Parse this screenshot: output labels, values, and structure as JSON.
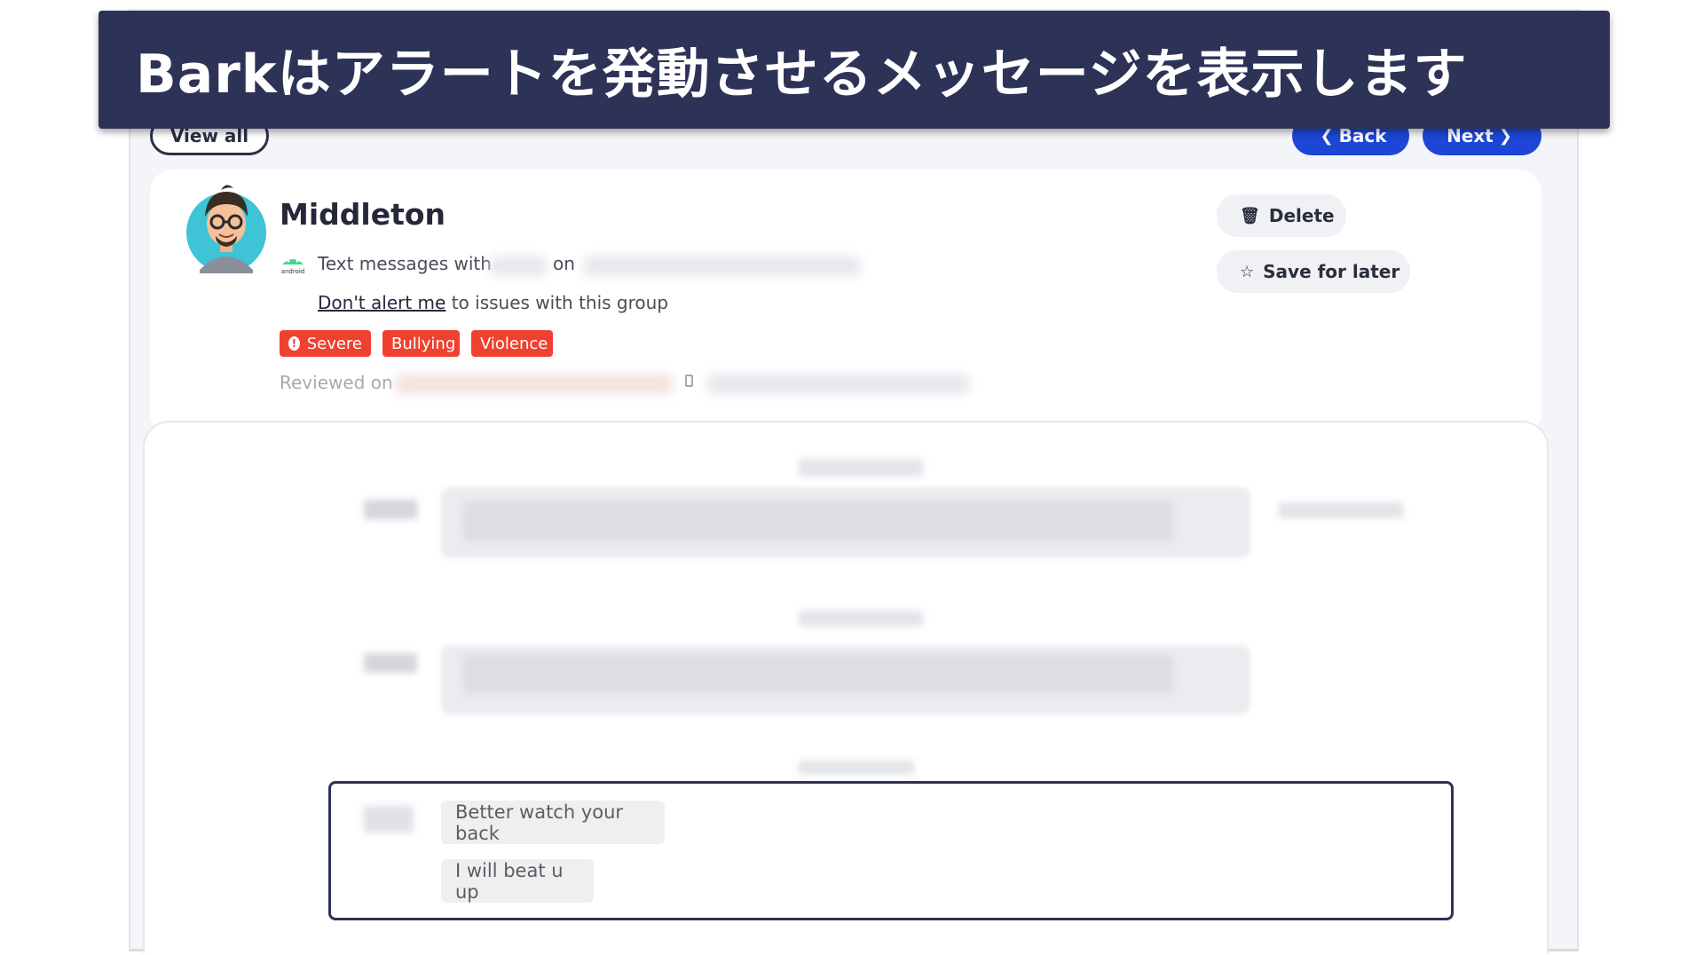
{
  "caption": {
    "text": "Barkはアラートを発動させるメッセージを表示します"
  },
  "nav": {
    "view_all_label": "View all",
    "back_label": "Back",
    "next_label": "Next"
  },
  "alert_card": {
    "name": "Middleton",
    "platform_icon": "android-icon",
    "messages_prefix": "Text messages with",
    "messages_on": "on",
    "dont_alert_link": "Don't alert me",
    "dont_alert_suffix": "to issues with this group",
    "tags": [
      {
        "label": "Severe",
        "icon": "exclamation-icon"
      },
      {
        "label": "Bullying"
      },
      {
        "label": "Violence"
      }
    ],
    "reviewed_label": "Reviewed on",
    "delete_label": "Delete",
    "save_label": "Save for later",
    "tag_color": "#f0402f"
  },
  "conversation": {
    "highlighted_messages": [
      {
        "text": "Better watch your back"
      },
      {
        "text": "I will beat u up"
      }
    ]
  },
  "colors": {
    "caption_bg": "#2d3257",
    "primary_button": "#1d46d6",
    "severity_red": "#f0402f"
  }
}
